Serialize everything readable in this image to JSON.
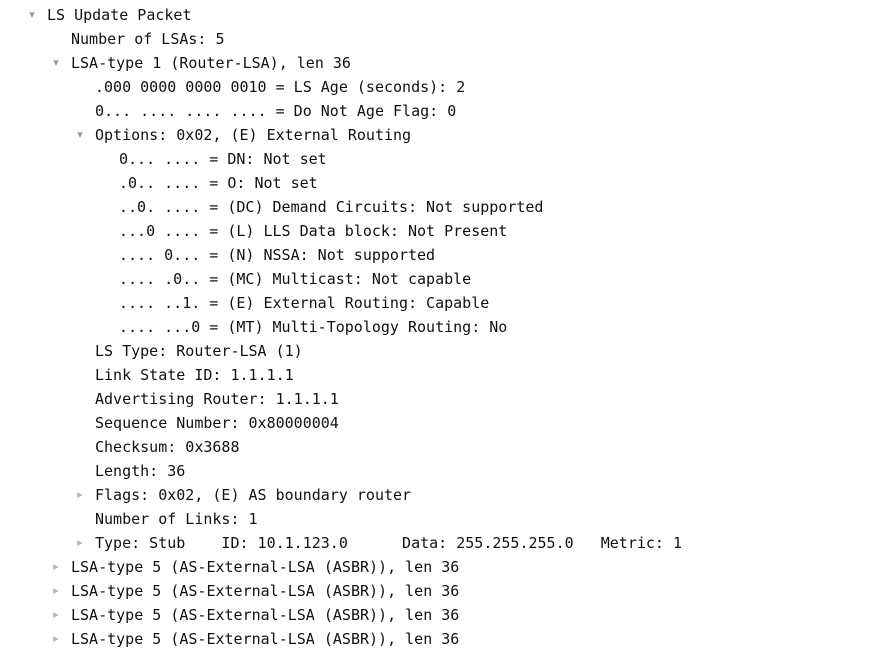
{
  "view": {
    "name": "packet-detail-tree",
    "background_color": "#ffffff",
    "text_color": "#111111",
    "twisty_color": "#9a9a9a",
    "expanded_icon": "chevron-down-icon",
    "collapsed_icon": "chevron-right-icon"
  },
  "tree": [
    {
      "depth": 0,
      "state": "expanded",
      "text": "LS Update Packet"
    },
    {
      "depth": 1,
      "state": "leaf",
      "text": "Number of LSAs: 5"
    },
    {
      "depth": 1,
      "state": "expanded",
      "text": "LSA-type 1 (Router-LSA), len 36"
    },
    {
      "depth": 2,
      "state": "leaf",
      "text": ".000 0000 0000 0010 = LS Age (seconds): 2"
    },
    {
      "depth": 2,
      "state": "leaf",
      "text": "0... .... .... .... = Do Not Age Flag: 0"
    },
    {
      "depth": 2,
      "state": "expanded",
      "text": "Options: 0x02, (E) External Routing"
    },
    {
      "depth": 3,
      "state": "leaf",
      "text": "0... .... = DN: Not set"
    },
    {
      "depth": 3,
      "state": "leaf",
      "text": ".0.. .... = O: Not set"
    },
    {
      "depth": 3,
      "state": "leaf",
      "text": "..0. .... = (DC) Demand Circuits: Not supported"
    },
    {
      "depth": 3,
      "state": "leaf",
      "text": "...0 .... = (L) LLS Data block: Not Present"
    },
    {
      "depth": 3,
      "state": "leaf",
      "text": ".... 0... = (N) NSSA: Not supported"
    },
    {
      "depth": 3,
      "state": "leaf",
      "text": ".... .0.. = (MC) Multicast: Not capable"
    },
    {
      "depth": 3,
      "state": "leaf",
      "text": ".... ..1. = (E) External Routing: Capable"
    },
    {
      "depth": 3,
      "state": "leaf",
      "text": ".... ...0 = (MT) Multi-Topology Routing: No"
    },
    {
      "depth": 2,
      "state": "leaf",
      "text": "LS Type: Router-LSA (1)"
    },
    {
      "depth": 2,
      "state": "leaf",
      "text": "Link State ID: 1.1.1.1"
    },
    {
      "depth": 2,
      "state": "leaf",
      "text": "Advertising Router: 1.1.1.1"
    },
    {
      "depth": 2,
      "state": "leaf",
      "text": "Sequence Number: 0x80000004"
    },
    {
      "depth": 2,
      "state": "leaf",
      "text": "Checksum: 0x3688"
    },
    {
      "depth": 2,
      "state": "leaf",
      "text": "Length: 36"
    },
    {
      "depth": 2,
      "state": "collapsed",
      "text": "Flags: 0x02, (E) AS boundary router"
    },
    {
      "depth": 2,
      "state": "leaf",
      "text": "Number of Links: 1"
    },
    {
      "depth": 2,
      "state": "collapsed",
      "text": "Type: Stub    ID: 10.1.123.0      Data: 255.255.255.0   Metric: 1"
    },
    {
      "depth": 1,
      "state": "collapsed",
      "text": "LSA-type 5 (AS-External-LSA (ASBR)), len 36"
    },
    {
      "depth": 1,
      "state": "collapsed",
      "text": "LSA-type 5 (AS-External-LSA (ASBR)), len 36"
    },
    {
      "depth": 1,
      "state": "collapsed",
      "text": "LSA-type 5 (AS-External-LSA (ASBR)), len 36"
    },
    {
      "depth": 1,
      "state": "collapsed",
      "text": "LSA-type 5 (AS-External-LSA (ASBR)), len 36"
    }
  ]
}
